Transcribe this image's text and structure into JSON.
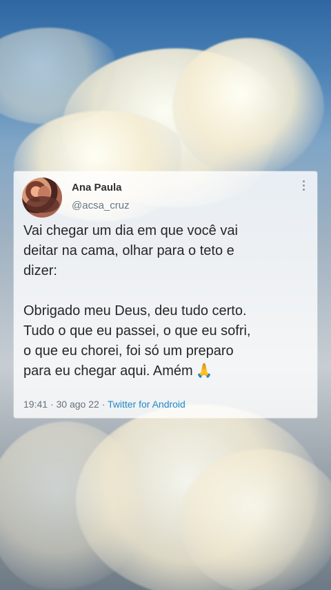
{
  "tweet": {
    "author_name": "Ana Paula",
    "author_handle": "@acsa_cruz",
    "paragraph_1": "Vai chegar um dia em que você vai\ndeitar na cama, olhar para o teto e\ndizer:",
    "paragraph_2": "Obrigado meu Deus, deu tudo certo.\nTudo o que eu passei, o que eu sofri,\no que eu chorei, foi só um preparo\npara eu chegar aqui. Amém",
    "emoji": "🙏",
    "time": "19:41",
    "date": "30 ago 22",
    "source": "Twitter for Android",
    "separator": "·"
  }
}
